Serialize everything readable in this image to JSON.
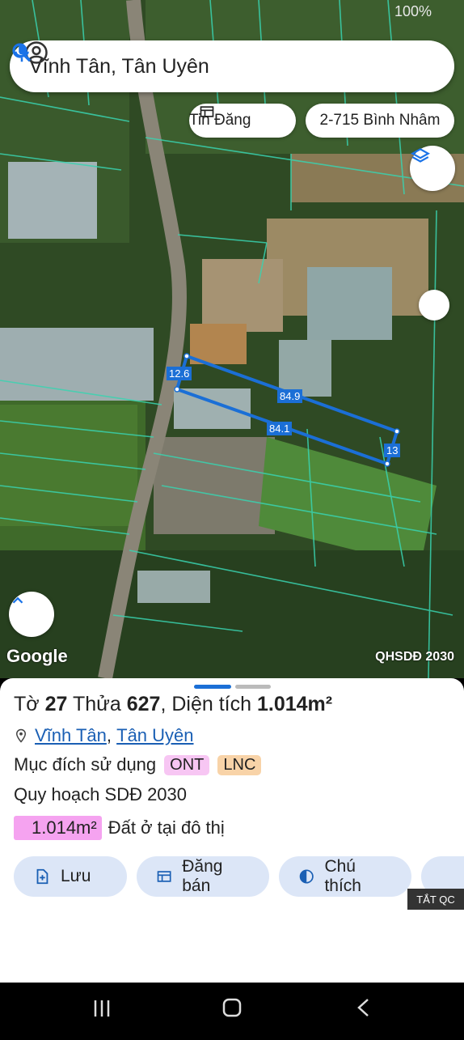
{
  "status": {
    "battery": "100%"
  },
  "search": {
    "query": "Vĩnh Tân, Tân Uyên"
  },
  "chips": {
    "listings": "Tin Đăng",
    "address": "2-715 Bình Nhâm"
  },
  "map": {
    "logo": "Google",
    "layer_label": "QHSDĐ 2030",
    "measurements": {
      "left": "12.6",
      "top": "84.9",
      "bottom": "84.1",
      "right": "13"
    }
  },
  "parcel": {
    "to_label": "Tờ",
    "to_value": "27",
    "thua_label": "Thửa",
    "thua_value": "627",
    "area_label": "Diện tích",
    "area_value": "1.014m²",
    "commune": "Vĩnh Tân",
    "district": "Tân Uyên",
    "purpose_label": "Mục đích sử dụng",
    "purpose_codes": [
      "ONT",
      "LNC"
    ],
    "plan_label": "Quy hoạch SDĐ 2030",
    "plan_area": "1.014m²",
    "plan_type": "Đất ở tại đô thị"
  },
  "actions": {
    "save": "Lưu",
    "sell": "Đăng bán",
    "legend": "Chú thích"
  },
  "ad": {
    "hide": "TẮT QC"
  },
  "colors": {
    "ont": "#f7c6f3",
    "lnc": "#f8d3a8",
    "button_bg": "#dce6f7",
    "link": "#1a5fb4",
    "measure": "#1b6fd6"
  }
}
